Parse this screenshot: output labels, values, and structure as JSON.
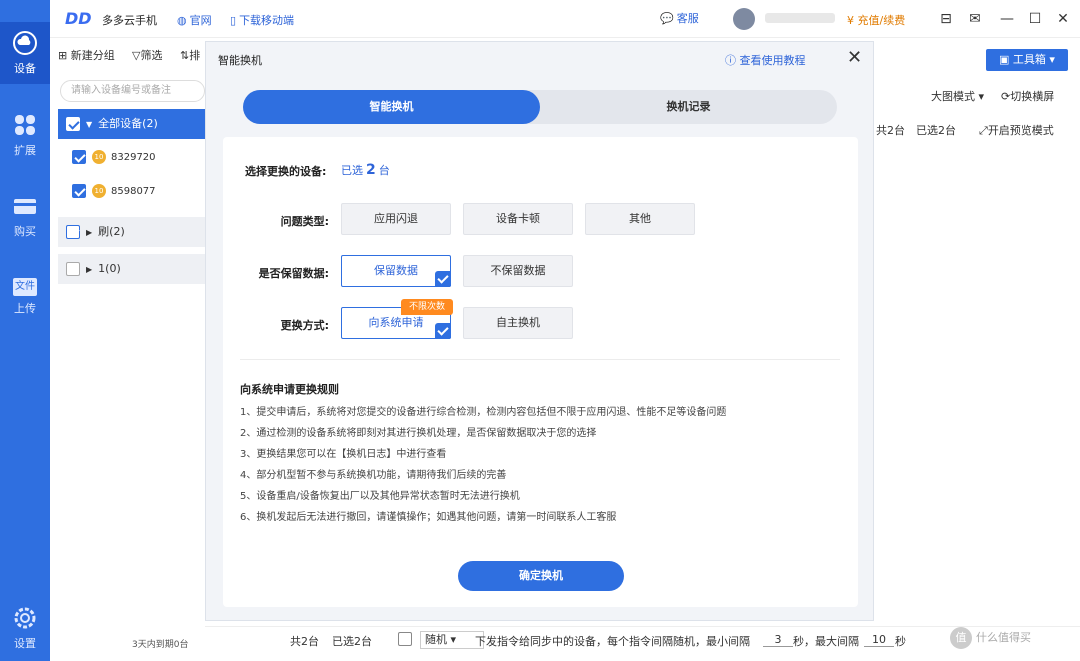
{
  "app": {
    "name": "多多云手机",
    "logo": "DD",
    "links": {
      "website": "官网",
      "download": "下载移动端"
    },
    "service": "客服",
    "recharge": "充值/续费",
    "icons": [
      "package-icon",
      "mail-icon",
      "minimize-icon",
      "maximize-icon",
      "close-icon"
    ]
  },
  "rail": [
    {
      "label": "设备",
      "icon": "cloud-icon",
      "active": true
    },
    {
      "label": "扩展",
      "icon": "extension-icon",
      "active": false
    },
    {
      "label": "购买",
      "icon": "card-icon",
      "active": false
    },
    {
      "label": "上传",
      "icon": "file-icon",
      "icon_text": "文件",
      "active": false
    },
    {
      "label": "设置",
      "icon": "gear-icon",
      "active": false
    }
  ],
  "left_panel": {
    "tools": {
      "new_group": "新建分组",
      "filter": "筛选",
      "sort": "排"
    },
    "search_placeholder": "请输入设备编号或备注",
    "groups": {
      "all": "全部设备(2)",
      "brush": "刷(2)",
      "one": "1(0)"
    },
    "devices": [
      {
        "badge": "10",
        "id": "8329720"
      },
      {
        "badge": "10",
        "id": "8598077"
      }
    ],
    "expire": "3天内到期0台"
  },
  "right_panel": {
    "toolbox": "工具箱",
    "big_mode": "大图模式",
    "switch_orientation": "切换横屏",
    "total": "共2台",
    "selected": "已选2台",
    "preview": "开启预览模式"
  },
  "bottom": {
    "total": "共2台",
    "selected": "已选2台",
    "mode_select": "随机",
    "sync_text": "下发指令给同步中的设备，每个指令间隔随机，最小间隔",
    "min_value": "3",
    "sec1": "秒，最大间隔",
    "max_value": "10",
    "sec2": "秒"
  },
  "modal": {
    "title": "智能换机",
    "help": "查看使用教程",
    "tabs": [
      "智能换机",
      "换机记录"
    ],
    "select_label": "选择更换的设备:",
    "select_prefix": "已选",
    "select_count": "2",
    "select_suffix": "台",
    "problem_label": "问题类型:",
    "problem_options": [
      "应用闪退",
      "设备卡顿",
      "其他"
    ],
    "keep_label": "是否保留数据:",
    "keep_options": [
      "保留数据",
      "不保留数据"
    ],
    "method_label": "更换方式:",
    "method_options": [
      "向系统申请",
      "自主换机"
    ],
    "unlimited_badge": "不限次数",
    "rules_title": "向系统申请更换规则",
    "rules": [
      "1、提交申请后，系统将对您提交的设备进行综合检测，检测内容包括但不限于应用闪退、性能不足等设备问题",
      "2、通过检测的设备系统将即刻对其进行换机处理，是否保留数据取决于您的选择",
      "3、更换结果您可以在【换机日志】中进行查看",
      "4、部分机型暂不参与系统换机功能，请期待我们后续的完善",
      "5、设备重启/设备恢复出厂以及其他异常状态暂时无法进行换机",
      "6、换机发起后无法进行撤回，请谨慎操作；如遇其他问题，请第一时间联系人工客服"
    ],
    "confirm": "确定换机"
  },
  "watermark": "什么值得买"
}
